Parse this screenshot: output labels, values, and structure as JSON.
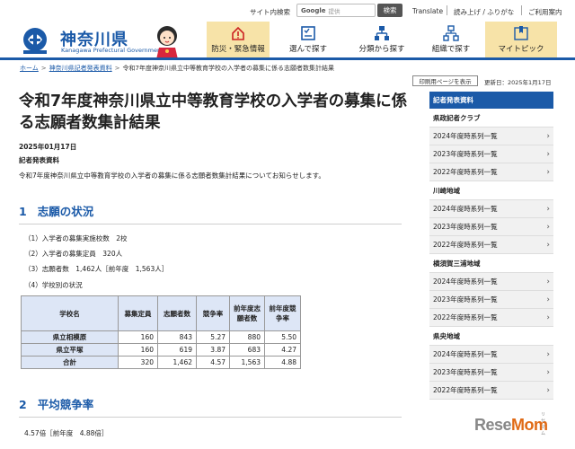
{
  "util": {
    "site_search_label": "サイト内検索",
    "search_brand": "Google",
    "search_placeholder": "提供",
    "search_button": "検索",
    "translate": "Translate",
    "read_aloud": "読み上げ / ふりがな",
    "guide": "ご利用案内"
  },
  "header": {
    "title": "神奈川県",
    "subtitle": "Kanagawa Prefectural Government",
    "nav": [
      "防災・緊急情報",
      "選んで探す",
      "分類から探す",
      "組織で探す",
      "マイトピック"
    ]
  },
  "breadcrumb": [
    "ホーム",
    "神奈川県記者発表資料",
    "令和7年度神奈川県立中等教育学校の入学者の募集に係る志願者数集計結果"
  ],
  "page": {
    "print_button": "印刷用ページを表示",
    "updated": "更新日：2025年1月17日",
    "title": "令和7年度神奈川県立中等教育学校の入学者の募集に係る志願者数集計結果",
    "date": "2025年01月17日",
    "kind": "記者発表資料",
    "intro": "令和7年度神奈川県立中等教育学校の入学者の募集に係る志願者数集計結果についてお知らせします。"
  },
  "section1": {
    "num": "1",
    "title": "志願の状況",
    "items": [
      "（1）入学者の募集実施校数　2校",
      "（2）入学者の募集定員　320人",
      "（3）志願者数　1,462人［前年度　1,563人］",
      "（4）学校別の状況"
    ]
  },
  "table": {
    "headers": [
      "学校名",
      "募集定員",
      "志願者数",
      "競争率",
      "前年度志願者数",
      "前年度競争率"
    ],
    "rows": [
      [
        "県立相模原",
        "160",
        "843",
        "5.27",
        "880",
        "5.50"
      ],
      [
        "県立平塚",
        "160",
        "619",
        "3.87",
        "683",
        "4.27"
      ],
      [
        "合計",
        "320",
        "1,462",
        "4.57",
        "1,563",
        "4.88"
      ]
    ]
  },
  "section2": {
    "num": "2",
    "title": "平均競争率",
    "value": "4.57倍［前年度　4.88倍］"
  },
  "sidebar": {
    "heading": "記者発表資料",
    "groups": [
      {
        "name": "県政記者クラブ",
        "items": [
          "2024年度時系列一覧",
          "2023年度時系列一覧",
          "2022年度時系列一覧"
        ]
      },
      {
        "name": "川崎地域",
        "items": [
          "2024年度時系列一覧",
          "2023年度時系列一覧",
          "2022年度時系列一覧"
        ]
      },
      {
        "name": "横須賀三浦地域",
        "items": [
          "2024年度時系列一覧",
          "2023年度時系列一覧",
          "2022年度時系列一覧"
        ]
      },
      {
        "name": "県央地域",
        "items": [
          "2024年度時系列一覧",
          "2023年度時系列一覧",
          "2022年度時系列一覧"
        ]
      }
    ]
  },
  "watermark": {
    "main_a": "Rese",
    "main_b": "Mom",
    "small": "リセマム"
  },
  "colors": {
    "brand_blue": "#1b5aa8",
    "emergency_bg": "#f7e3a8",
    "table_header": "#dde6f6"
  }
}
